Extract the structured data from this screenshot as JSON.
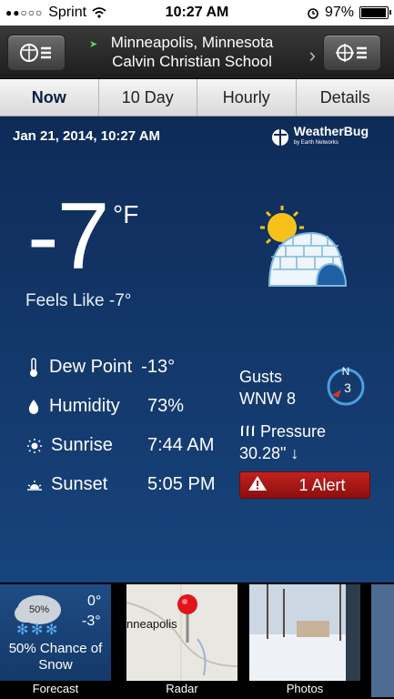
{
  "status_bar": {
    "carrier": "Sprint",
    "signal": "●●○○○",
    "time": "10:27 AM",
    "battery": "97%",
    "battery_level": 0.97
  },
  "header": {
    "city": "Minneapolis, Minnesota",
    "station": "Calvin Christian School"
  },
  "tabs": [
    {
      "label": "Now"
    },
    {
      "label": "10 Day"
    },
    {
      "label": "Hourly"
    },
    {
      "label": "Details"
    }
  ],
  "main": {
    "date": "Jan 21, 2014, 10:27 AM",
    "brand": "WeatherBug",
    "brand_sub": "by Earth Networks",
    "temperature": "-7",
    "unit": "°F",
    "feels_like": "Feels Like -7°",
    "dew_point_label": "Dew Point",
    "dew_point": "-13°",
    "humidity_label": "Humidity",
    "humidity": "73%",
    "sunrise_label": "Sunrise",
    "sunrise": "7:44 AM",
    "sunset_label": "Sunset",
    "sunset": "5:05 PM",
    "gusts_label": "Gusts",
    "gusts": "WNW 8",
    "compass_dir": "N",
    "compass_speed": "3",
    "pressure_label": "Pressure",
    "pressure": "30.28\" ↓",
    "alert": "1 Alert"
  },
  "tiles": {
    "forecast": {
      "label": "Forecast",
      "hi": "0°",
      "lo": "-3°",
      "chance_pct": "50%",
      "chance": "50% Chance of Snow"
    },
    "radar": {
      "label": "Radar",
      "city": "nneapolis"
    },
    "photos": {
      "label": "Photos"
    }
  },
  "colors": {
    "accent": "#c0221d",
    "background": "#0d2a55",
    "compass": "#4a9fe0"
  }
}
